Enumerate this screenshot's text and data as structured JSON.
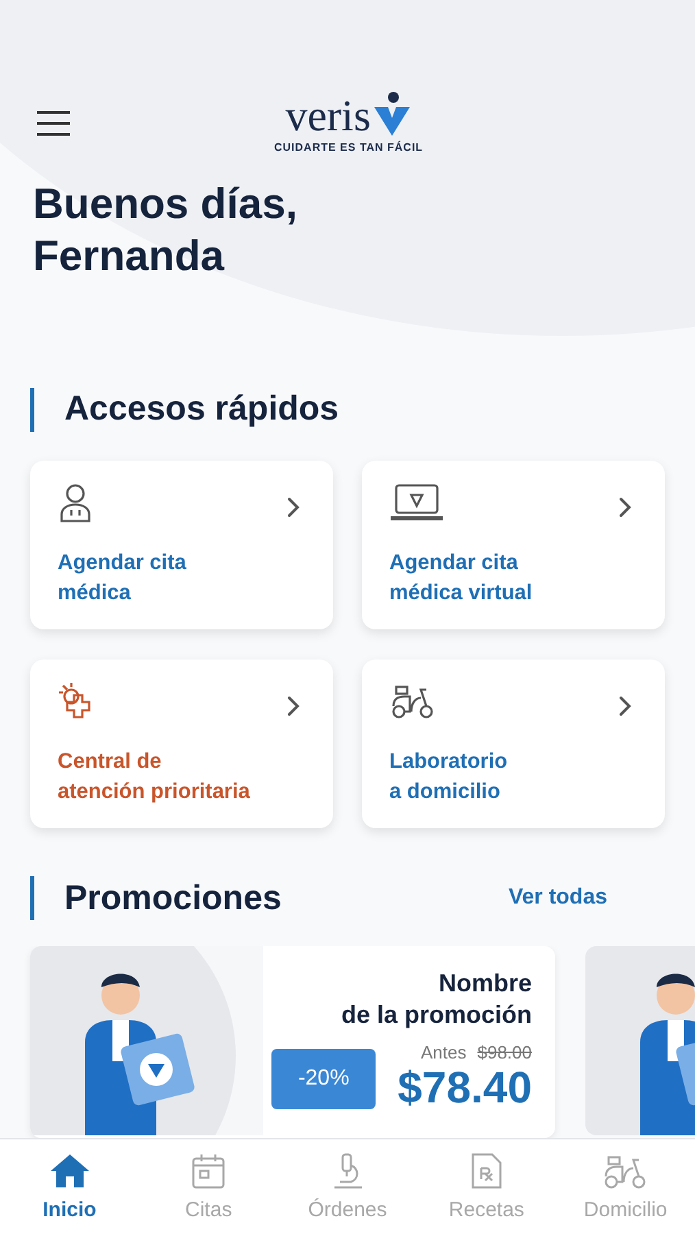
{
  "header": {
    "logo_text": "veris",
    "tagline": "CUIDARTE ES TAN FÁCIL"
  },
  "greeting": "Buenos días,\nFernanda",
  "quick_access": {
    "title": "Accesos rápidos",
    "items": [
      {
        "label": "Agendar cita\nmédica",
        "color": "#1f6fb5"
      },
      {
        "label": "Agendar cita\nmédica virtual",
        "color": "#1f6fb5"
      },
      {
        "label": "Central de\natención prioritaria",
        "color": "#c9552b"
      },
      {
        "label": "Laboratorio\na domicilio",
        "color": "#1f6fb5"
      }
    ]
  },
  "promotions": {
    "title": "Promociones",
    "link": "Ver todas",
    "items": [
      {
        "kind": "full",
        "title": "Nombre\nde la promoción",
        "discount": "-20%",
        "before_label": "Antes",
        "before_price": "$98.00",
        "price": "$78.40"
      },
      {
        "kind": "picture"
      }
    ]
  },
  "nav": [
    {
      "label": "Inicio",
      "selected": true
    },
    {
      "label": "Citas",
      "selected": false
    },
    {
      "label": "Órdenes",
      "selected": false
    },
    {
      "label": "Recetas",
      "selected": false
    },
    {
      "label": "Domicilio",
      "selected": false
    }
  ]
}
